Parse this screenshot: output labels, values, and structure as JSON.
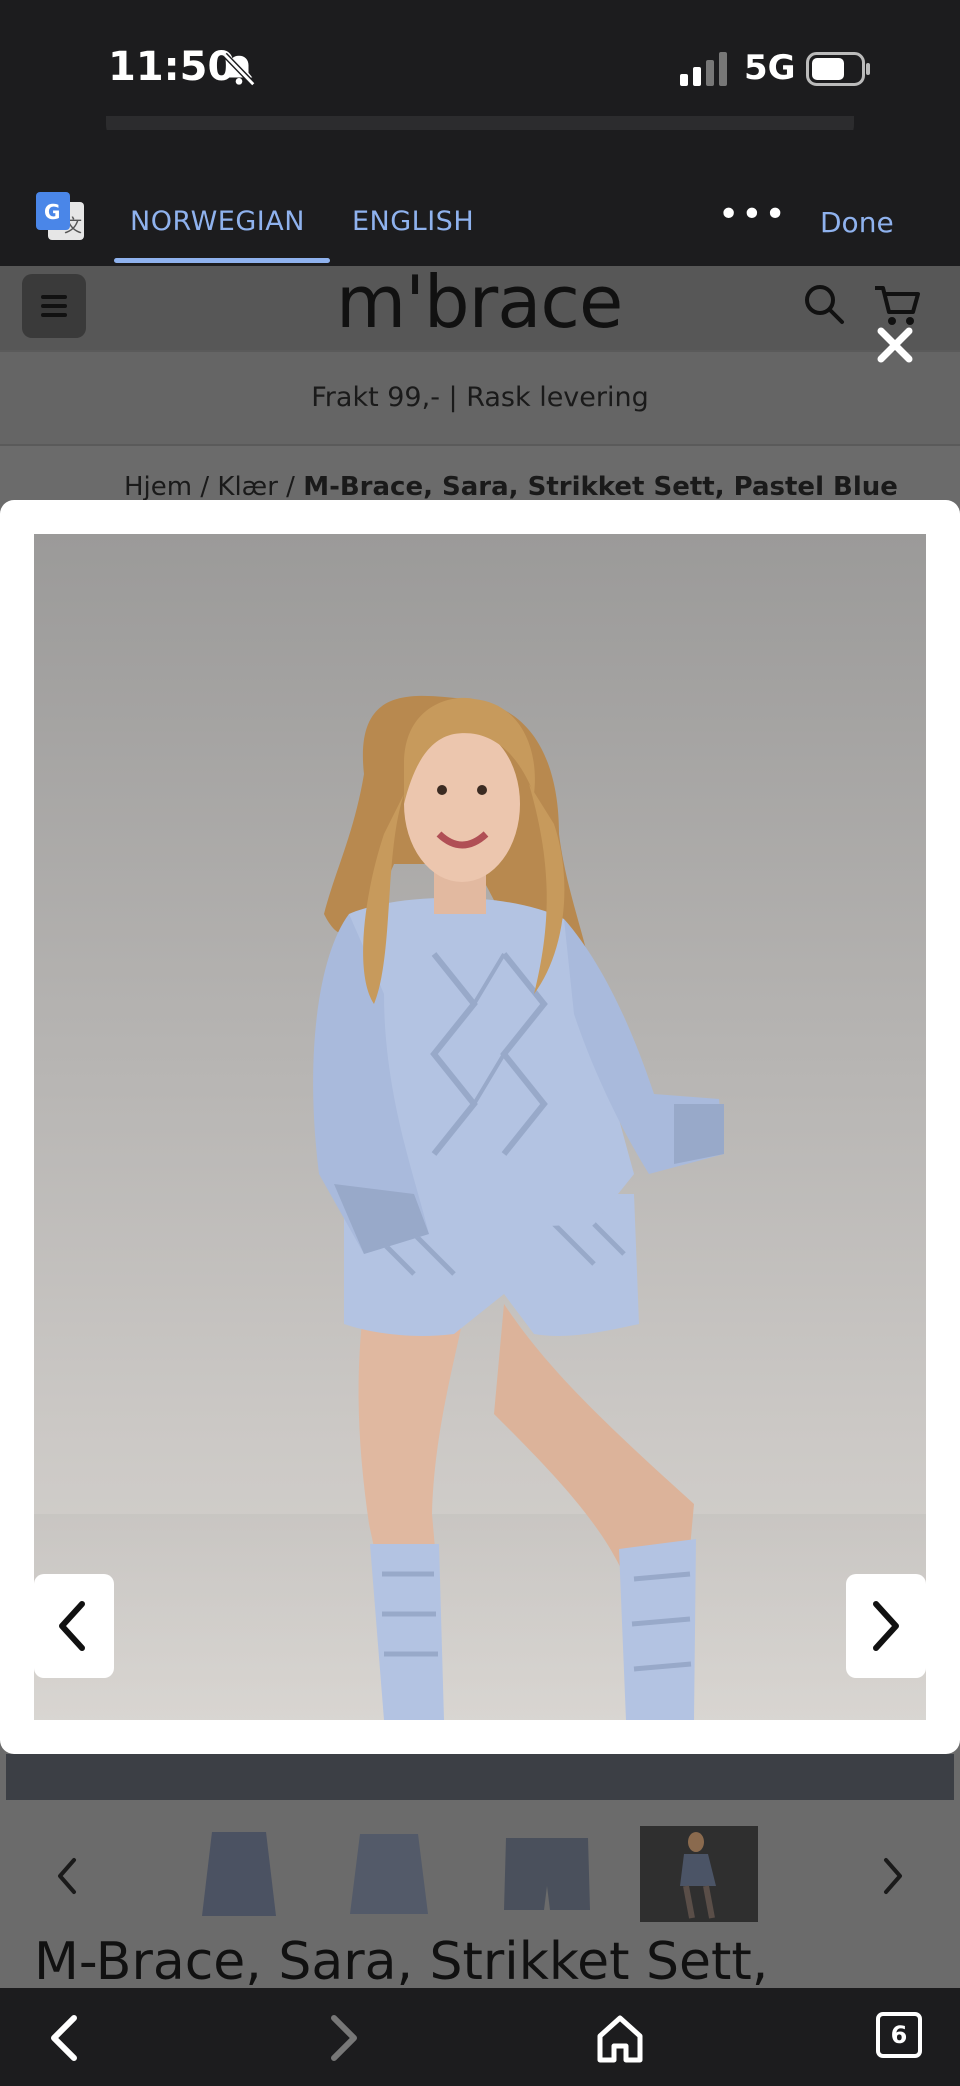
{
  "status_bar": {
    "time": "11:50",
    "network": "5G"
  },
  "translate_bar": {
    "tabs": [
      {
        "label": "NORWEGIAN",
        "active": true
      },
      {
        "label": "ENGLISH",
        "active": false
      }
    ],
    "more_label": "•••",
    "done_label": "Done"
  },
  "site": {
    "logo": "m'brace",
    "promo": "Frakt 99,- | Rask levering",
    "breadcrumb": {
      "home": "Hjem",
      "separator": " / ",
      "category": "Klær",
      "current": "M-Brace, Sara, Strikket Sett, Pastel Blue"
    }
  },
  "product": {
    "title": "M-Brace, Sara, Strikket Sett,",
    "colors": {
      "knit": "#b3c3e2",
      "knit_shadow": "#98a9c9"
    }
  },
  "browser": {
    "tab_count": "6"
  },
  "icons": [
    "bell-slash-icon",
    "signal-icon",
    "battery-icon",
    "google-translate-icon",
    "menu-icon",
    "search-icon",
    "cart-icon",
    "close-icon",
    "chevron-left-icon",
    "chevron-right-icon",
    "back-icon",
    "forward-icon",
    "home-icon",
    "tabs-icon"
  ]
}
